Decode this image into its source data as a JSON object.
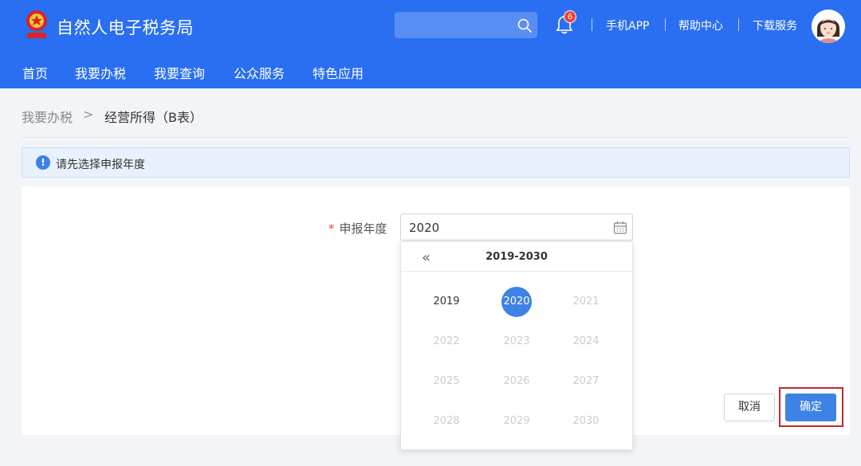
{
  "header": {
    "site_title": "自然人电子税务局",
    "notification_count": "6",
    "links": [
      "手机APP",
      "帮助中心",
      "下载服务"
    ],
    "brand_color": "#2a6ff1"
  },
  "nav": {
    "items": [
      "首页",
      "我要办税",
      "我要查询",
      "公众服务",
      "特色应用"
    ]
  },
  "breadcrumb": {
    "parent": "我要办税",
    "separator": ">",
    "current": "经营所得（B表）"
  },
  "notice": {
    "text": "请先选择申报年度",
    "icon": "info-icon"
  },
  "form": {
    "required_mark": "*",
    "year_label": "申报年度",
    "year_value": "2020"
  },
  "year_picker": {
    "prev_symbol": "«",
    "range": "2019-2030",
    "years": [
      "2019",
      "2020",
      "2021",
      "2022",
      "2023",
      "2024",
      "2025",
      "2026",
      "2027",
      "2028",
      "2029",
      "2030"
    ],
    "selected": "2020"
  },
  "buttons": {
    "cancel": "取消",
    "confirm": "确定"
  }
}
